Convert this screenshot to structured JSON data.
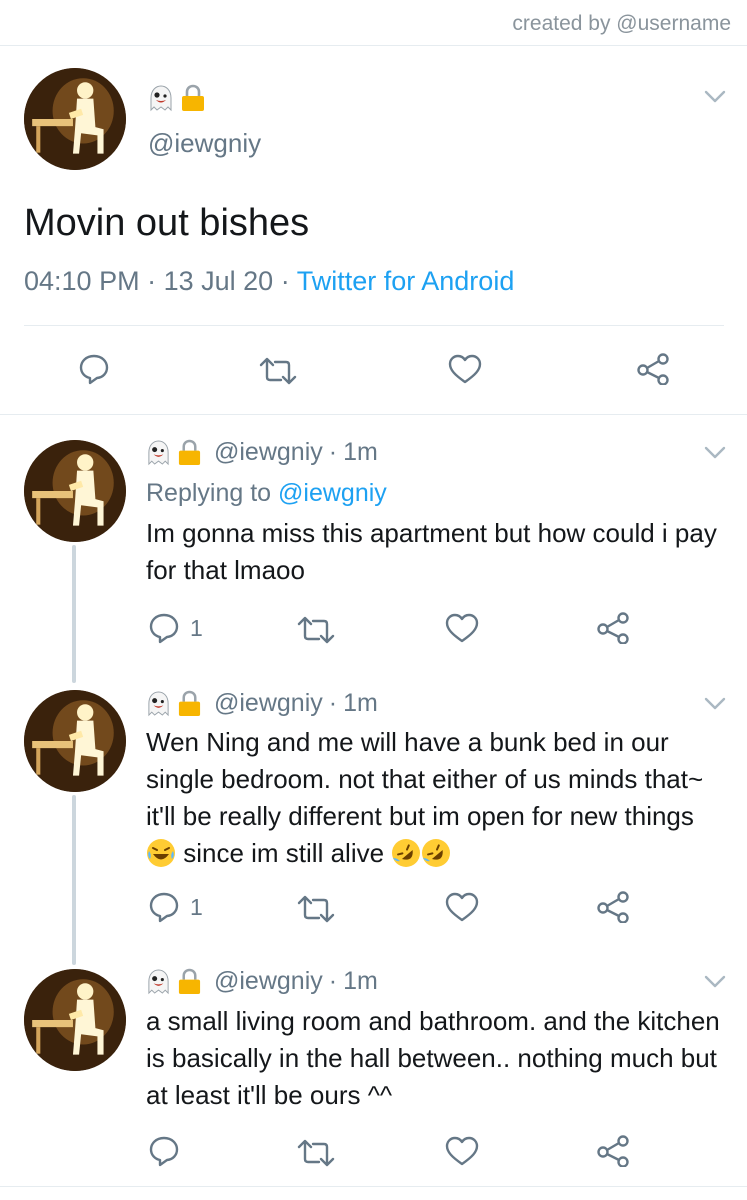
{
  "header": {
    "credit": "created by @username"
  },
  "main_tweet": {
    "emoji_icons": [
      "ghost-emoji",
      "lock-emoji"
    ],
    "handle": "@iewgniy",
    "text": "Movin out bishes",
    "time": "04:10 PM",
    "date": "13 Jul 20",
    "source": "Twitter for Android",
    "sep": "·",
    "actions": [
      "reply-icon",
      "retweet-icon",
      "like-icon",
      "share-icon"
    ]
  },
  "replies": [
    {
      "handle": "@iewgniy",
      "age": "1m",
      "replying_label": "Replying to",
      "replying_handle": "@iewgniy",
      "text": "Im gonna miss this apartment but how could i pay for that lmaoo",
      "reply_count": "1"
    },
    {
      "handle": "@iewgniy",
      "age": "1m",
      "text_parts": [
        "Wen Ning and me will have a bunk bed in our single bedroom. not that either of us minds that~ it'll be really different but im open for new things ",
        " since im still alive "
      ],
      "inline_emojis": [
        "laughing-tears-emoji",
        "rofl-emoji",
        "rofl-emoji"
      ],
      "reply_count": "1"
    },
    {
      "handle": "@iewgniy",
      "age": "1m",
      "text": "a small living room and bathroom. and the kitchen is basically in the hall between.. nothing much but at least it'll be ours ^^",
      "reply_count": ""
    }
  ],
  "colors": {
    "link": "#1da1f2",
    "muted": "#657786",
    "text": "#14171a",
    "rule": "#e6ecf0",
    "thread": "#ccd6dd"
  }
}
